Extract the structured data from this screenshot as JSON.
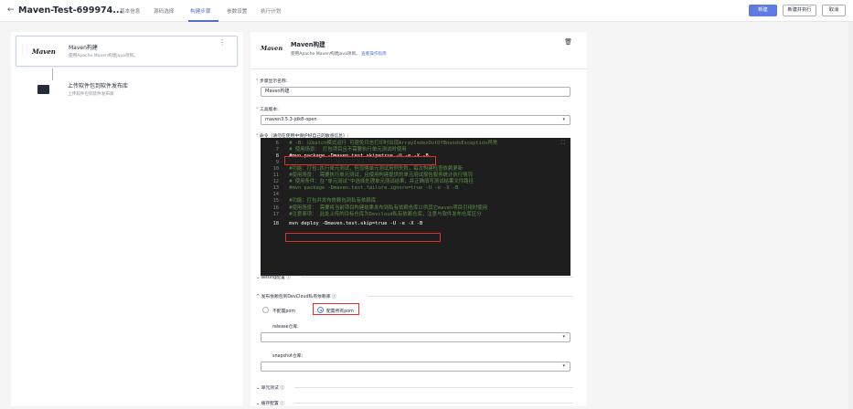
{
  "header": {
    "back_icon": "arrow-left-icon",
    "title": "Maven-Test-699974...",
    "tabs": [
      {
        "label": "基本信息"
      },
      {
        "label": "源码选择"
      },
      {
        "label": "构建步骤",
        "active": true
      },
      {
        "label": "参数设置"
      },
      {
        "label": "执行计划"
      }
    ],
    "buttons": {
      "create": "新建",
      "create_run": "新建并执行",
      "cancel": "取消"
    }
  },
  "colors": {
    "accent": "#5e7ce0",
    "highlight_box": "#e0302a",
    "required": "#f66f6a"
  },
  "steps": [
    {
      "logo": "Maven",
      "title": "Maven构建",
      "desc": "使用Apache Maven构建Java项目。",
      "selected": true
    },
    {
      "logo": "",
      "icon": "terminal-icon",
      "title": "上传软件包到软件发布库",
      "desc": "上传软件包到软件发布库"
    }
  ],
  "detail": {
    "logo": "Maven",
    "title": "Maven构建",
    "desc": "使用Apache Maven构建Java项目。",
    "desc_link": "查看操作指南",
    "delete_icon": "trash-icon",
    "step_name_label": "步骤显示名称:",
    "step_name_value": "Maven构建",
    "tool_label": "工具版本:",
    "tool_value": "maven3.5.3-jdk8-open",
    "command_label": "命令（请勿在使用中保护好自己的敏感信息）:",
    "code_lines": [
      {
        "n": "6",
        "t": "  # -B: 以batch模式运行 可避免日志打印时出现ArrayIndexOutOfBoundsException异常",
        "cls": "cm"
      },
      {
        "n": "7",
        "t": "  # 使用场景： 打包项目且不需要执行单元测试时使用",
        "cls": "cm"
      },
      {
        "n": "8",
        "t": "  #mvn package -Dmaven.test.skip=true -U -e -X -B",
        "cls": "cm"
      },
      {
        "n": "9",
        "t": "",
        "cls": "cm"
      },
      {
        "n": "10",
        "t": "  #功能：打包;执行单元测试，但忽略单元测试用例失败，每次构建检查依赖更新",
        "cls": "cm"
      },
      {
        "n": "11",
        "t": "  #使用场景： 需要执行单元测试，且使用构建提供的单元测试报告服务统计执行情况",
        "cls": "cm"
      },
      {
        "n": "12",
        "t": "  # 使用条件：在\"单元测试\"中选择处理单元测试结果，并正确填写测试结果文件路径",
        "cls": "cm"
      },
      {
        "n": "13",
        "t": "  #mvn package -Dmaven.test.failure.ignore=true -U -e -X -B",
        "cls": "cm"
      },
      {
        "n": "14",
        "t": "",
        "cls": "cm"
      },
      {
        "n": "15",
        "t": "  #功能：打包并发布依赖包到私有依赖库",
        "cls": "cm"
      },
      {
        "n": "16",
        "t": "  #使用场景： 需要将当前项目构建结果发布到私有依赖仓库以供其它maven项目引用时使用",
        "cls": "cm"
      },
      {
        "n": "17",
        "t": "  #注意事项： 此处上传的目标仓库为Devcloud私有依赖仓库，注意与软件发布仓库区分",
        "cls": "cm"
      },
      {
        "n": "18",
        "t": "  mvn deploy -Dmaven.test.skip=true -U -e -X -B",
        "cls": "nm"
      }
    ],
    "expand_icon": "fullscreen-icon",
    "setting_label": "setting配置",
    "release_section_label": "发布依赖包到DevCloud私有依赖库",
    "radio_no": "不配置pom",
    "radio_yes": "配置所有pom",
    "release_repo_label": "release仓库:",
    "snapshot_repo_label": "snapshot仓库:",
    "unit_test_label": "单元测试",
    "cache_label": "缓存配置",
    "help_icon": "help-circle-icon",
    "chevron_right": "›",
    "chevron_down": "⌄"
  }
}
